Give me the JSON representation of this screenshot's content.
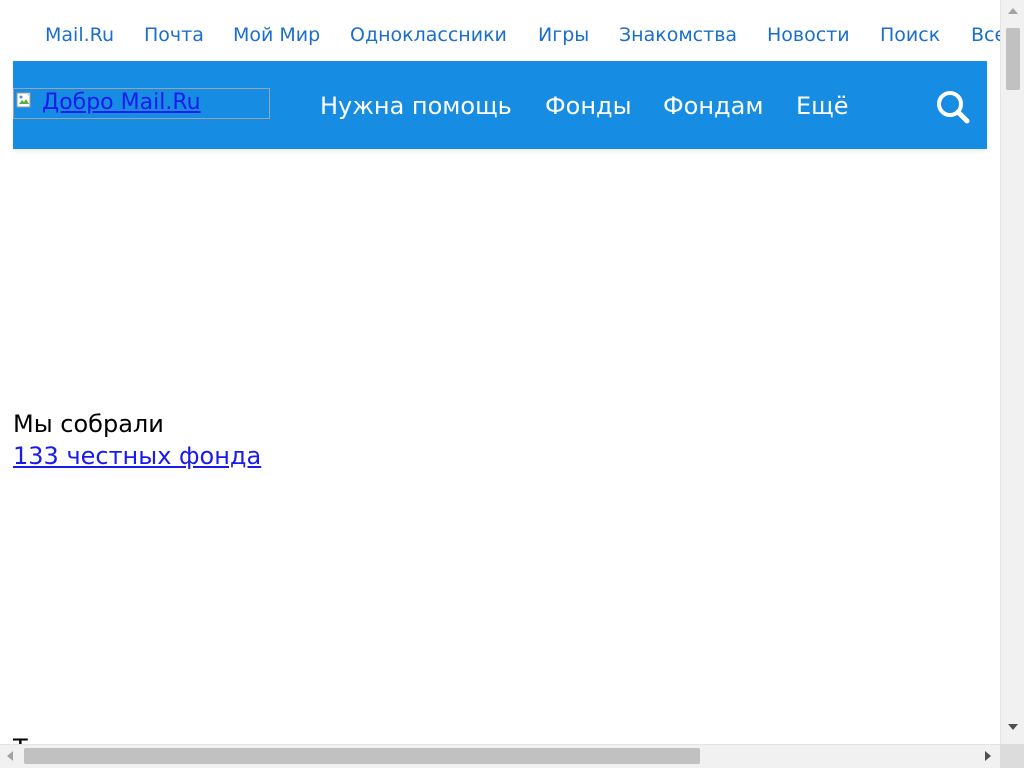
{
  "portal_nav": {
    "items": [
      {
        "label": "Mail.Ru"
      },
      {
        "label": "Почта"
      },
      {
        "label": "Мой Мир"
      },
      {
        "label": "Одноклассники"
      },
      {
        "label": "Игры"
      },
      {
        "label": "Знакомства"
      },
      {
        "label": "Новости"
      },
      {
        "label": "Поиск"
      },
      {
        "label": "Все"
      }
    ],
    "color": "#1a6fcc"
  },
  "header": {
    "logo_alt": "Добро Mail.Ru",
    "logo_icon": "broken-image-icon",
    "background": "#168de2",
    "nav": [
      {
        "label": "Нужна помощь"
      },
      {
        "label": "Фонды"
      },
      {
        "label": "Фондам"
      },
      {
        "label": "Ещё"
      }
    ],
    "search_icon": "search-icon"
  },
  "main": {
    "collected_label": "Мы собрали",
    "funds_link": "133 честных фонда",
    "cut_off_text": "Т"
  }
}
